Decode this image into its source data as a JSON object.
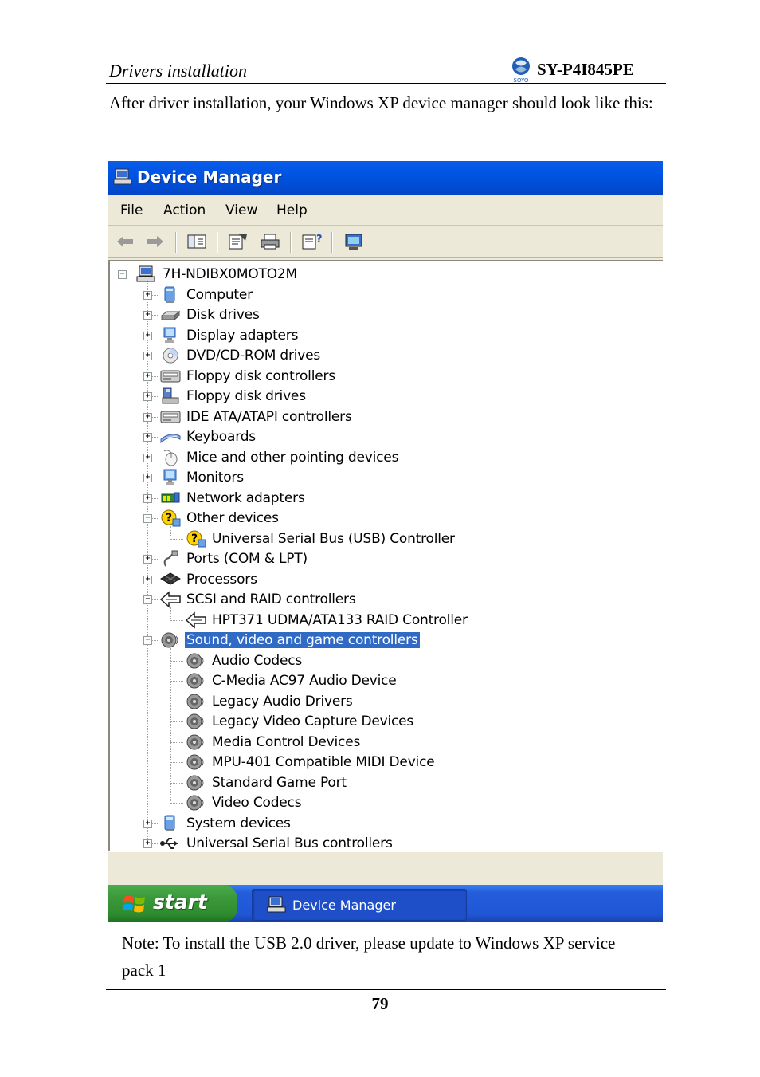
{
  "doc_header": {
    "section_title": "Drivers installation",
    "model": "SY-P4I845PE",
    "logo_text": "SOYO"
  },
  "intro_text": "After driver installation, your Windows XP device manager should look like this:",
  "window": {
    "title": "Device Manager",
    "menu": [
      "File",
      "Action",
      "View",
      "Help"
    ],
    "toolbar_icons": [
      "back-icon",
      "forward-icon",
      "show-hide-tree-icon",
      "properties-icon",
      "print-icon",
      "help-icon",
      "scan-hardware-icon"
    ],
    "tree": {
      "root": "7H-NDIBX0MOTO2M",
      "items": [
        {
          "label": "Computer",
          "icon": "computer-icon",
          "expanded": false
        },
        {
          "label": "Disk drives",
          "icon": "disk-drive-icon",
          "expanded": false
        },
        {
          "label": "Display adapters",
          "icon": "display-adapter-icon",
          "expanded": false
        },
        {
          "label": "DVD/CD-ROM drives",
          "icon": "cdrom-icon",
          "expanded": false
        },
        {
          "label": "Floppy disk controllers",
          "icon": "controller-icon",
          "expanded": false
        },
        {
          "label": "Floppy disk drives",
          "icon": "floppy-icon",
          "expanded": false
        },
        {
          "label": "IDE ATA/ATAPI controllers",
          "icon": "controller-icon",
          "expanded": false
        },
        {
          "label": "Keyboards",
          "icon": "keyboard-icon",
          "expanded": false
        },
        {
          "label": "Mice and other pointing devices",
          "icon": "mouse-icon",
          "expanded": false
        },
        {
          "label": "Monitors",
          "icon": "monitor-icon",
          "expanded": false
        },
        {
          "label": "Network adapters",
          "icon": "network-icon",
          "expanded": false
        },
        {
          "label": "Other devices",
          "icon": "unknown-device-icon",
          "expanded": true,
          "children": [
            "Universal Serial Bus (USB) Controller"
          ]
        },
        {
          "label": "Ports (COM & LPT)",
          "icon": "port-icon",
          "expanded": false
        },
        {
          "label": "Processors",
          "icon": "processor-icon",
          "expanded": false
        },
        {
          "label": "SCSI and RAID controllers",
          "icon": "scsi-icon",
          "expanded": true,
          "children": [
            "HPT371 UDMA/ATA133 RAID Controller"
          ]
        },
        {
          "label": "Sound, video and game controllers",
          "icon": "sound-icon",
          "expanded": true,
          "selected": true,
          "children": [
            "Audio Codecs",
            "C-Media AC97 Audio Device",
            "Legacy Audio Drivers",
            "Legacy Video Capture Devices",
            "Media Control Devices",
            "MPU-401 Compatible MIDI Device",
            "Standard Game Port",
            "Video Codecs"
          ]
        },
        {
          "label": "System devices",
          "icon": "system-icon",
          "expanded": false
        },
        {
          "label": "Universal Serial Bus controllers",
          "icon": "usb-icon",
          "expanded": false
        }
      ]
    },
    "taskbar": {
      "start_label": "start",
      "task_label": "Device Manager"
    },
    "colors": {
      "titlebar": "#0054e3",
      "selection": "#316ac5",
      "start_button": "#3c9b3c",
      "window_bg": "#ece9d8"
    }
  },
  "note_text": "Note: To install the USB 2.0 driver, please update to Windows XP service pack 1",
  "page_number": "79"
}
